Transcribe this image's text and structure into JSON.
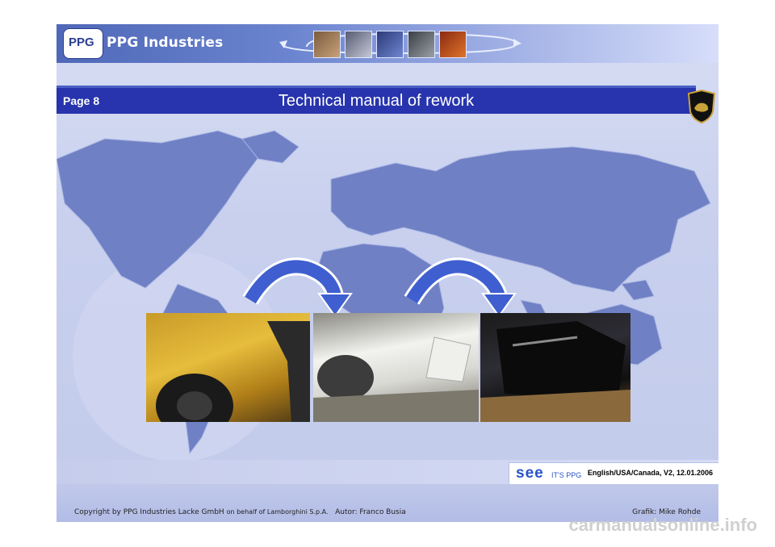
{
  "header": {
    "brand": "PPG Industries",
    "logo_letters": "PPG"
  },
  "titlebar": {
    "page": "Page 8",
    "title": "Technical manual of rework"
  },
  "photos": [
    {
      "icon": "car-rear-yellow-photo"
    },
    {
      "icon": "car-rear-primer-photo"
    },
    {
      "icon": "car-rear-black-photo"
    }
  ],
  "see_logo": {
    "mark": "see",
    "tagline": "IT'S PPG",
    "version": "English/USA/Canada, V2, 12.01.2006"
  },
  "footer": {
    "copyright": "Copyright by PPG Industries Lacke GmbH",
    "behalf": "on behalf of Lamborghini S.p.A.",
    "author": "Autor: Franco Busia",
    "grafik": "Grafik: Mike Rohde"
  },
  "watermark": "carmanualsonline.info",
  "colors": {
    "title_bar": "#2734ad",
    "map_land": "#6f80c4",
    "background": "#c8d0ee",
    "arrow": "#3f5fd0"
  }
}
